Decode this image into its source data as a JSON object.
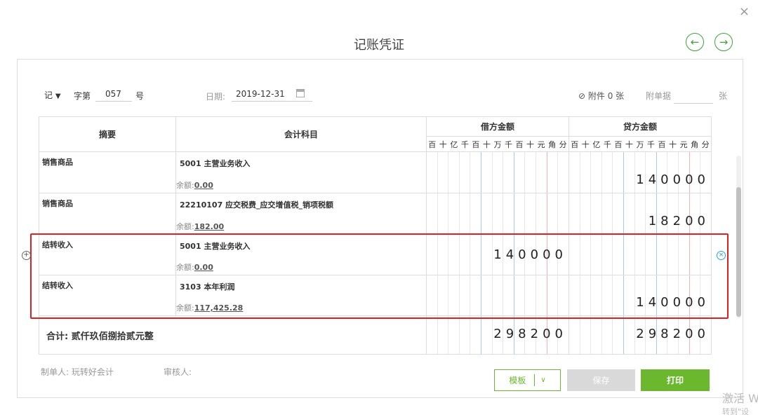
{
  "window": {
    "close": "×"
  },
  "title": "记账凭证",
  "nav": {
    "prev": "←",
    "next": "→"
  },
  "header": {
    "type": "记",
    "word_label": "字第",
    "number": "057",
    "number_suffix": "号",
    "date_label": "日期:",
    "date": "2019-12-31",
    "attach_label": "附件 0 张",
    "receipt_label": "附单据",
    "receipt_unit": "张"
  },
  "table": {
    "col_summary": "摘要",
    "col_subject": "会计科目",
    "col_debit": "借方金额",
    "col_credit": "贷方金额",
    "digit_units": [
      "百",
      "十",
      "亿",
      "千",
      "百",
      "十",
      "万",
      "千",
      "百",
      "十",
      "元",
      "角",
      "分"
    ],
    "rows": [
      {
        "summary": "销售商品",
        "subject": "5001 主营业务收入",
        "balance_label": "余额:",
        "balance": "0.00",
        "debit": "",
        "credit": "140000"
      },
      {
        "summary": "销售商品",
        "subject": "22210107 应交税费_应交增值税_销项税额",
        "balance_label": "余额:",
        "balance": "182.00",
        "debit": "",
        "credit": "18200"
      },
      {
        "summary": "结转收入",
        "subject": "5001 主营业务收入",
        "balance_label": "余额:",
        "balance": "0.00",
        "debit": "140000",
        "credit": ""
      },
      {
        "summary": "结转收入",
        "subject": "3103 本年利润",
        "balance_label": "余额:",
        "balance": "117,425.28",
        "debit": "",
        "credit": "140000"
      }
    ],
    "total_label": "合计:",
    "total_words": "贰仟玖佰捌拾贰元整",
    "total_debit": "298200",
    "total_credit": "298200"
  },
  "footer": {
    "maker": "制单人: 玩转好会计",
    "reviewer": "审核人:",
    "template_btn": "模板",
    "save_btn": "保存",
    "print_btn": "打印"
  },
  "watermark": {
    "line1": "激活 W",
    "line2": "转到\"设"
  },
  "colors": {
    "accent": "#6bb82f",
    "highlight": "#e02020",
    "save_disabled": "#d9d9d9"
  }
}
